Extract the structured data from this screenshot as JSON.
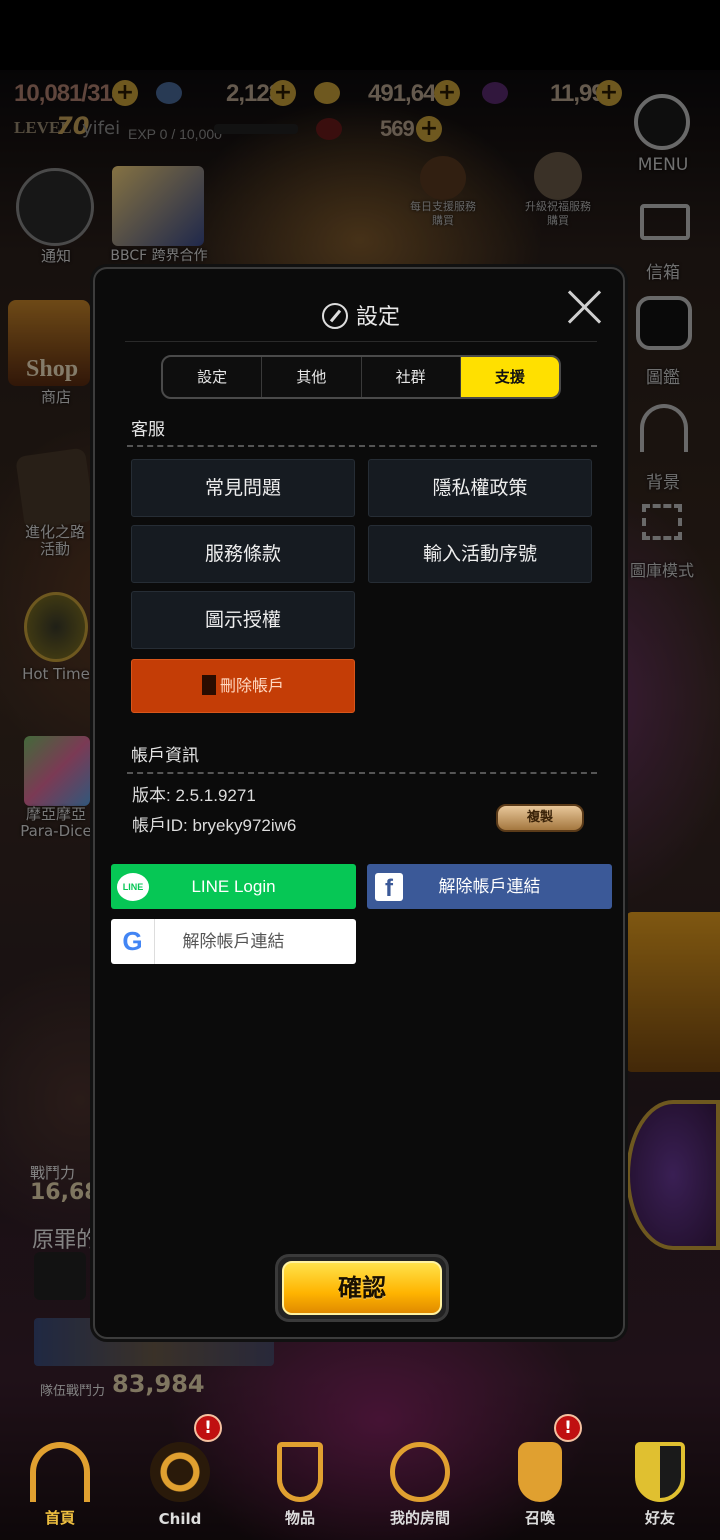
{
  "hud": {
    "stamina": "10,081/314",
    "gems": "2,123",
    "gold": "491,646",
    "crystals": "11,991",
    "level_label": "LEVEL",
    "level": "70",
    "player_name": "yifei",
    "exp": "EXP 0 / 10,000",
    "tickets": "569",
    "daily_support": "每日支援服務\n購買",
    "upgrade_blessing": "升級祝福服務\n購買",
    "event_notice": "通知",
    "collab": "BBCF 跨界合作"
  },
  "right_menu": {
    "menu": "MENU",
    "mail": "信箱",
    "codex": "圖鑑",
    "background": "背景",
    "gallery": "圖庫模式"
  },
  "left_menu": {
    "shop": "商店",
    "shop_logo": "Shop",
    "upgrade_event": "進化之路\n活動",
    "hot_time": "Hot Time",
    "para_dice": "摩亞摩亞\nPara-Dice"
  },
  "bottom_hud": {
    "combat_power_label": "戰鬥力",
    "combat_power": "16,684",
    "team_name": "原罪的",
    "team_power_label": "隊伍戰鬥力",
    "team_power": "83,984"
  },
  "modal": {
    "title": "設定",
    "tabs": [
      {
        "label": "設定",
        "active": false
      },
      {
        "label": "其他",
        "active": false
      },
      {
        "label": "社群",
        "active": false
      },
      {
        "label": "支援",
        "active": true
      }
    ],
    "support_section": "客服",
    "buttons": {
      "faq": "常見問題",
      "privacy": "隱私權政策",
      "terms": "服務條款",
      "redeem": "輸入活動序號",
      "icon_license": "圖示授權",
      "delete_account": "刪除帳戶"
    },
    "account_section": "帳戶資訊",
    "version": "版本: 2.5.1.9271",
    "account_id": "帳戶ID: bryeky972iw6",
    "copy": "複製",
    "line_login": "LINE Login",
    "line_logo": "LINE",
    "facebook_unlink": "解除帳戶連結",
    "google_unlink": "解除帳戶連結",
    "confirm": "確認"
  },
  "bottom_nav": [
    {
      "label": "首頁",
      "badge": ""
    },
    {
      "label": "Child",
      "badge": "!"
    },
    {
      "label": "物品",
      "badge": ""
    },
    {
      "label": "我的房間",
      "badge": ""
    },
    {
      "label": "召喚",
      "badge": "!"
    },
    {
      "label": "好友",
      "badge": ""
    }
  ],
  "colors": {
    "accent": "#ffe000",
    "danger": "#c43d06",
    "line": "#06c755",
    "facebook": "#3b5998"
  }
}
